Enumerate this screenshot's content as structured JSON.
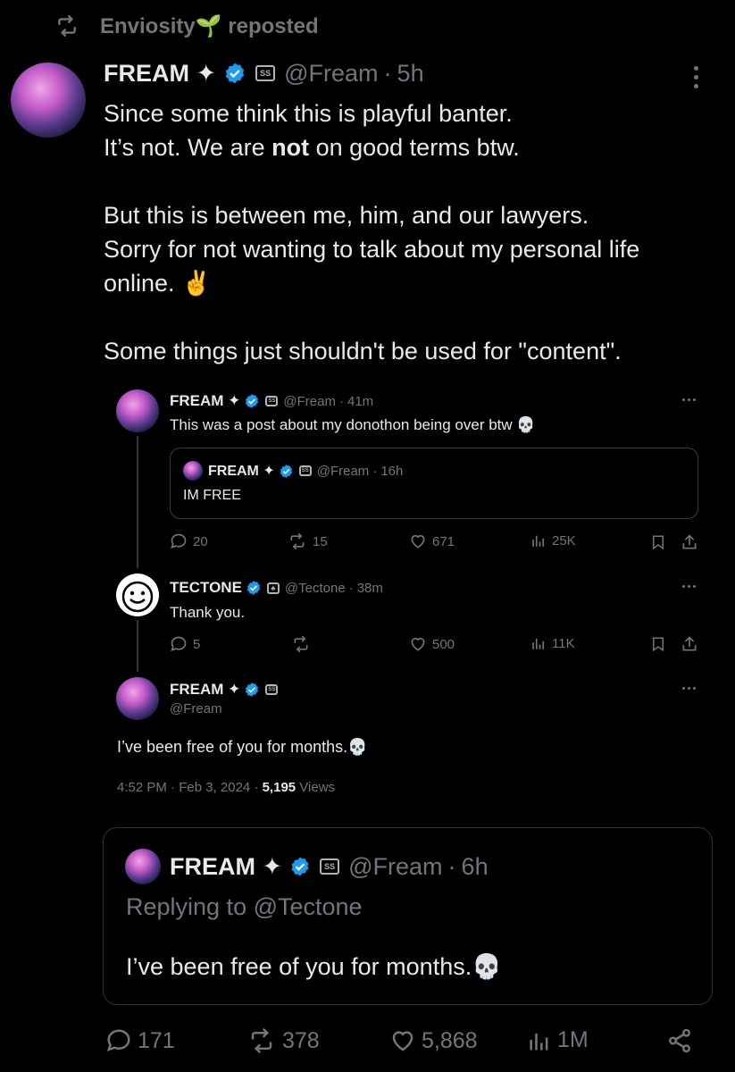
{
  "repost": {
    "label": "Enviosity🌱 reposted"
  },
  "main_post": {
    "name": "FREAM ✦",
    "handle": "@Fream",
    "time": "5h",
    "line1": "Since some think this is playful banter.",
    "line2_a": "It’s not. We are ",
    "line2_b": "not",
    "line2_c": " on good terms btw.",
    "line3": "But this is between me, him, and our lawyers.",
    "line4": "Sorry for not wanting to talk about my personal life",
    "line5": "online. ✌️",
    "line6": "Some things just shouldn't be used for \"content\"."
  },
  "embedded": {
    "post1": {
      "name": "FREAM ✦",
      "handle": "@Fream",
      "time": "41m",
      "text": "This was a post about my donothon being over btw 💀",
      "quote": {
        "name": "FREAM ✦",
        "handle": "@Fream",
        "time": "16h",
        "text": "IM FREE"
      },
      "replies": "20",
      "reposts": "15",
      "likes": "671",
      "views": "25K"
    },
    "post2": {
      "name": "TECTONE",
      "handle": "@Tectone",
      "time": "38m",
      "text": "Thank you.",
      "replies": "5",
      "reposts": "",
      "likes": "500",
      "views": "11K"
    },
    "post3": {
      "name": "FREAM ✦",
      "handle": "@Fream",
      "text": "I’ve been free of you for months.💀",
      "timestamp": "4:52 PM · Feb 3, 2024 · ",
      "views_count": "5,195",
      "views_label": " Views"
    }
  },
  "quote_card": {
    "name": "FREAM ✦",
    "handle": "@Fream",
    "time": "6h",
    "replying": "Replying to @Tectone",
    "text": "I’ve been free of you for months.💀"
  },
  "actions": {
    "replies": "171",
    "reposts": "378",
    "likes": "5,868",
    "views": "1M"
  },
  "colors": {
    "verified": "#1d9bf0",
    "background": "#000000",
    "muted": "#71767b"
  }
}
